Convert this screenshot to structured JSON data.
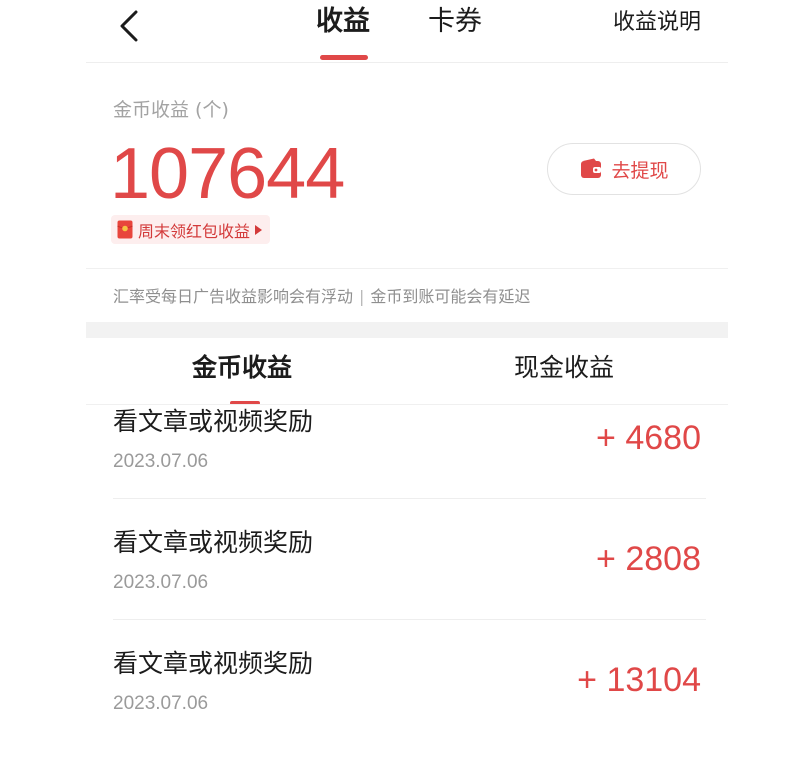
{
  "header": {
    "tabs": [
      {
        "label": "收益",
        "active": true
      },
      {
        "label": "卡券",
        "active": false
      }
    ],
    "explain_label": "收益说明",
    "back_icon": "chevron-left-icon"
  },
  "balance": {
    "label": "金币收益 (个)",
    "value": "107644",
    "withdraw_label": "去提现",
    "withdraw_icon": "wallet-icon",
    "weekend_label": "周末领红包收益",
    "weekend_icon": "red-packet-icon"
  },
  "notice": {
    "part1": "汇率受每日广告收益影响会有浮动",
    "separator": "|",
    "part2": "金币到账可能会有延迟"
  },
  "sub_tabs": [
    {
      "label": "金币收益",
      "active": true
    },
    {
      "label": "现金收益",
      "active": false
    }
  ],
  "records": [
    {
      "title": "看文章或视频奖励",
      "date": "2023.07.06",
      "amount": "+ 4680"
    },
    {
      "title": "看文章或视频奖励",
      "date": "2023.07.06",
      "amount": "+ 2808"
    },
    {
      "title": "看文章或视频奖励",
      "date": "2023.07.06",
      "amount": "+ 13104"
    }
  ],
  "colors": {
    "accent": "#e04848",
    "badge_bg": "#fdeeee",
    "muted_text": "#9a9a9a"
  }
}
